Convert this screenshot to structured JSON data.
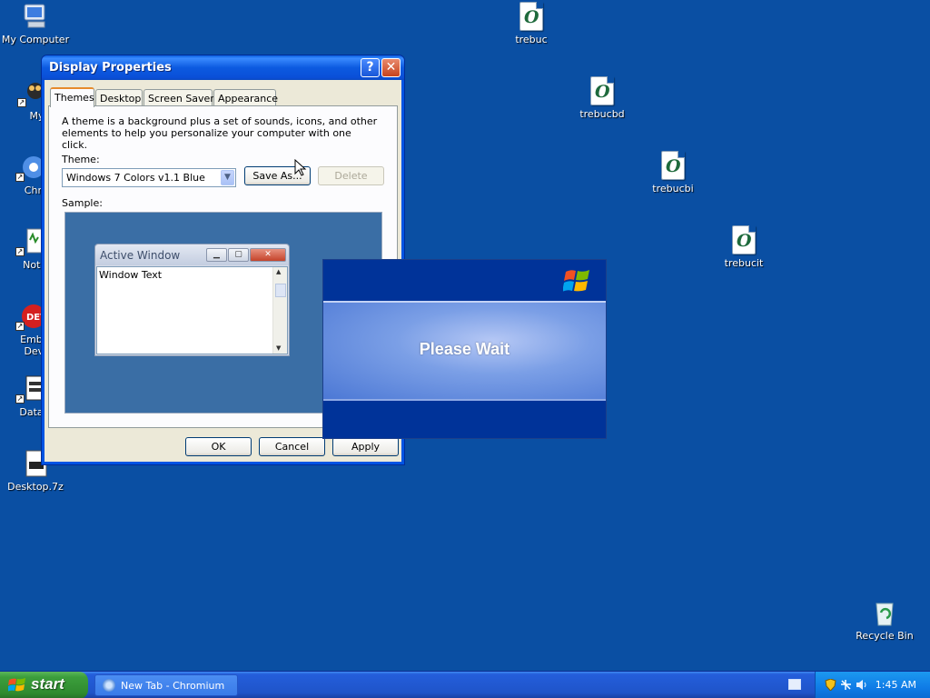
{
  "desktop": {
    "icons": {
      "my_computer": "My Computer",
      "mypal": "MyPa",
      "chromium": "Chrom",
      "notepad": "Notepa",
      "embarcadero_1": "Embarc",
      "embarcadero_2": "Dev-C",
      "datawatch": "DataWa",
      "desktop7z": "Desktop.7z",
      "trebuc": "trebuc",
      "trebucbd": "trebucbd",
      "trebucbi": "trebucbi",
      "trebucit": "trebucit",
      "recycle_bin": "Recycle Bin",
      "font_glyph": "O"
    }
  },
  "dialog": {
    "title": "Display Properties",
    "help_glyph": "?",
    "close_glyph": "✕",
    "tabs": [
      "Themes",
      "Desktop",
      "Screen Saver",
      "Appearance"
    ],
    "description": "A theme is a background plus a set of sounds, icons, and other elements to help you personalize your computer with one click.",
    "theme_label": "Theme:",
    "theme_value": "Windows 7 Colors v1.1 Blue",
    "save_as_label": "Save As...",
    "delete_label": "Delete",
    "sample_label": "Sample:",
    "sample": {
      "active_window_title": "Active Window",
      "window_text": "Window Text"
    },
    "buttons": {
      "ok": "OK",
      "cancel": "Cancel",
      "apply": "Apply"
    }
  },
  "splash": {
    "message": "Please Wait"
  },
  "taskbar": {
    "start_label": "start",
    "task_item": "New Tab - Chromium",
    "clock": "1:45 AM"
  },
  "colors": {
    "desktop": "#0a4fa3",
    "title_bar": "#0054e3",
    "start_button": "#3c9e3c",
    "splash_bg": "#003399"
  }
}
